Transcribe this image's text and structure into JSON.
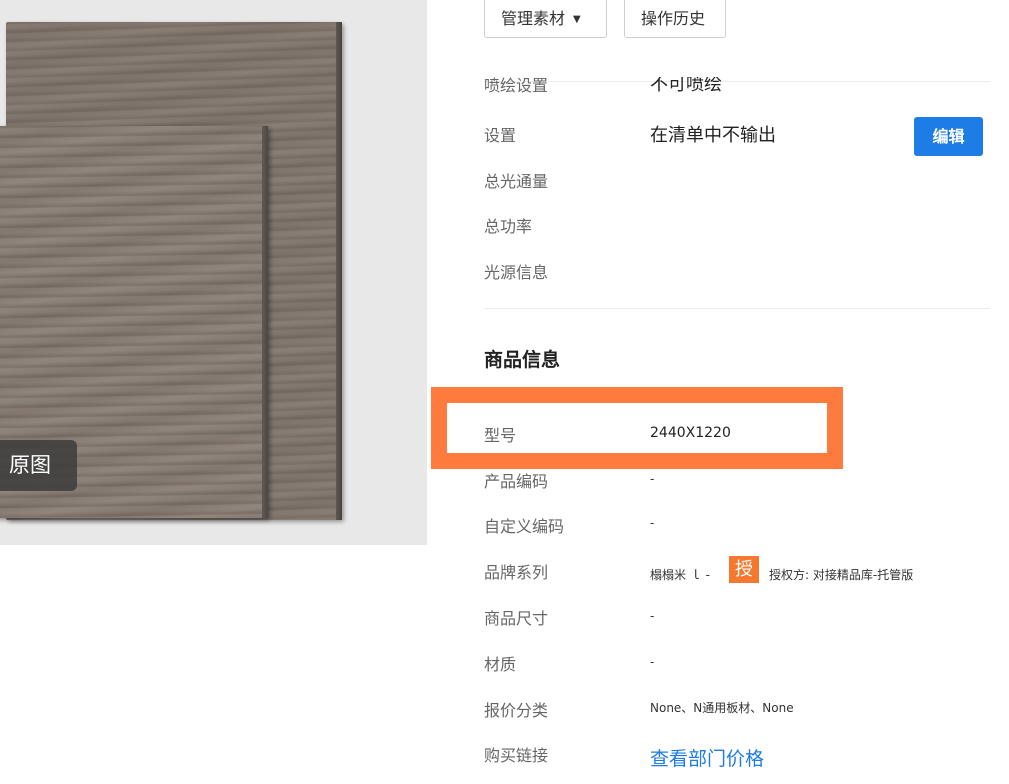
{
  "preview": {
    "original_label": "原图"
  },
  "toolbar": {
    "manage_label": "管理素材",
    "history_label": "操作历史"
  },
  "properties_top": [
    {
      "label": "喷绘设置",
      "value": "不可喷绘"
    },
    {
      "label": "设置",
      "value": "在清单中不输出",
      "action": "编辑"
    },
    {
      "label": "总光通量",
      "value": ""
    },
    {
      "label": "总功率",
      "value": ""
    },
    {
      "label": "光源信息",
      "value": ""
    }
  ],
  "product": {
    "title": "商品信息",
    "rows": [
      {
        "label": "型号",
        "value": "2440X1220"
      },
      {
        "label": "产品编码",
        "value": "-"
      },
      {
        "label": "自定义编码",
        "value": "-"
      },
      {
        "label": "品牌系列",
        "value": "榻榻米 ｌ -",
        "badge": "授",
        "auth": "授权方: 对接精品库-托管版"
      },
      {
        "label": "商品尺寸",
        "value": "-"
      },
      {
        "label": "材质",
        "value": "-"
      },
      {
        "label": "报价分类",
        "value": "None、N通用板材、None"
      },
      {
        "label": "购买链接",
        "value": "查看部门价格"
      }
    ]
  },
  "colors": {
    "accent": "#1e7ce6",
    "highlight": "#ff7a3d",
    "badge": "#f4792f"
  }
}
